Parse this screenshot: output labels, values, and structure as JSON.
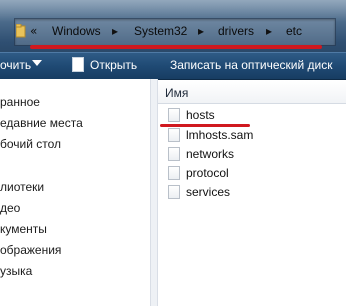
{
  "breadcrumb": {
    "overflow": "«",
    "separator": "▸",
    "items": [
      "Windows",
      "System32",
      "drivers",
      "etc"
    ]
  },
  "toolbar": {
    "organize_label": "очить",
    "open_label": "Открыть",
    "burn_label": "Записать на оптический диск"
  },
  "nav": {
    "items": [
      "ранное",
      "едавние места",
      "бочий стол",
      "",
      "лиотеки",
      "део",
      "кументы",
      "ображения",
      "узыка"
    ]
  },
  "files": {
    "column_name": "Имя",
    "items": [
      "hosts",
      "lmhosts.sam",
      "networks",
      "protocol",
      "services"
    ]
  },
  "colors": {
    "annotation": "#d0181f",
    "toolbar": "#1f4a74"
  }
}
